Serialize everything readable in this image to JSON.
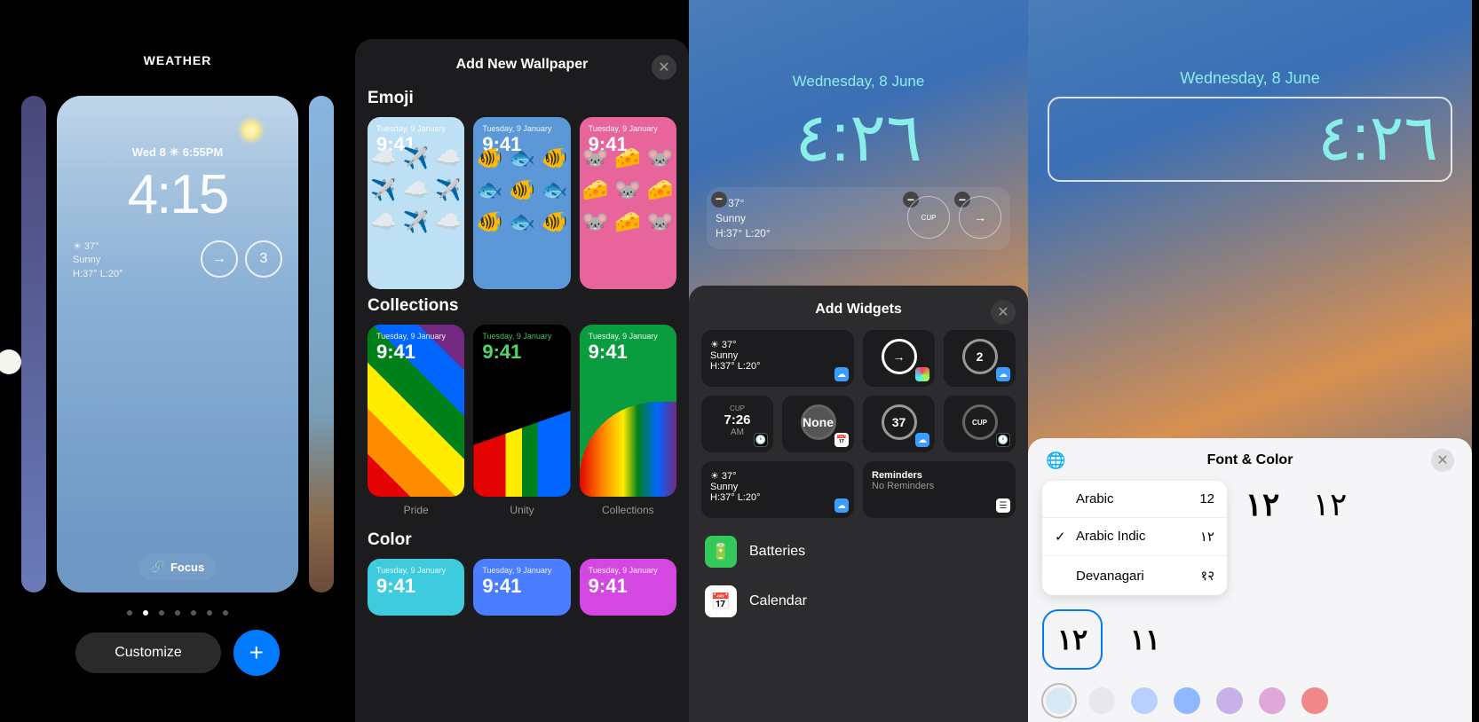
{
  "panel1": {
    "title": "WEATHER",
    "date": "Wed 8  ☀  6:55PM",
    "time": "4:15",
    "weather": {
      "temp": "☀ 37°",
      "cond": "Sunny",
      "hilo": "H:37° L:20°"
    },
    "widget_arrow": "→",
    "widget_count": "3",
    "focus": "Focus",
    "customize": "Customize",
    "add": "+"
  },
  "panel2": {
    "title": "Add New Wallpaper",
    "sections": {
      "emoji": "Emoji",
      "collections": "Collections",
      "color": "Color"
    },
    "thumb_date": "Tuesday, 9 January",
    "thumb_time": "9:41",
    "labels": {
      "pride": "Pride",
      "unity": "Unity",
      "coll": "Collections"
    }
  },
  "panel3": {
    "date": "Wednesday, 8 June",
    "time": "٤:٢٦",
    "top_weather": {
      "temp": "☀ 37°",
      "cond": "Sunny",
      "hilo": "H:37° L:20°"
    },
    "cup": "CUP",
    "sheet_title": "Add Widgets",
    "widgets": {
      "weather": {
        "temp": "☀ 37°",
        "cond": "Sunny",
        "hilo": "H:37° L:20°"
      },
      "fitness": "→",
      "uv": "2",
      "clock_time": "7:26",
      "clock_ampm": "AM",
      "cal": "None",
      "aqi": "37",
      "cup2": "CUP",
      "reminders_title": "Reminders",
      "reminders_sub": "No Reminders"
    },
    "apps": {
      "batteries": "Batteries",
      "calendar": "Calendar"
    }
  },
  "panel4": {
    "date": "Wednesday, 8 June",
    "time": "٤:٢٦",
    "sheet_title": "Font & Color",
    "options": [
      {
        "name": "Arabic",
        "sample": "12",
        "checked": false
      },
      {
        "name": "Arabic Indic",
        "sample": "١٢",
        "checked": true
      },
      {
        "name": "Devanagari",
        "sample": "१२",
        "checked": false
      }
    ],
    "font_previews": [
      "١٢",
      "١٢"
    ],
    "font_swatches": [
      "١٢",
      "١١"
    ],
    "colors": [
      "#d8e8f5",
      "#e8e8ea",
      "#b8d0ff",
      "#90b8ff",
      "#c8b0e8",
      "#e0a8d8",
      "#f08888"
    ]
  }
}
